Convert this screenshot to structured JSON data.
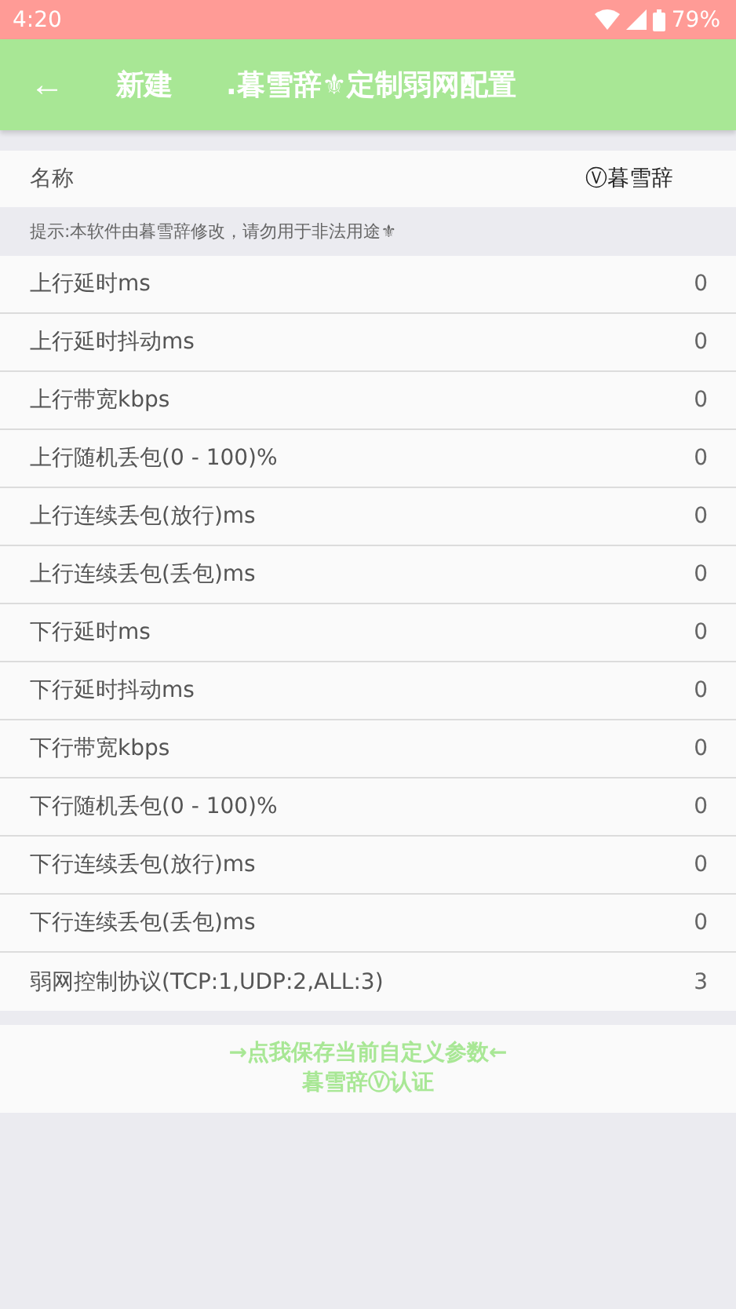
{
  "status_bar": {
    "time": "4:20",
    "battery": "79%"
  },
  "app_bar": {
    "back": "←",
    "title_prefix": "新建",
    "title": ".暮雪辞⚜定制弱网配置"
  },
  "name_row": {
    "label": "名称",
    "value": "Ⓥ暮雪辞"
  },
  "hint": "提示:本软件由暮雪辞修改，请勿用于非法用途⚜",
  "settings": [
    {
      "label": "上行延时ms",
      "value": "0"
    },
    {
      "label": "上行延时抖动ms",
      "value": "0"
    },
    {
      "label": "上行带宽kbps",
      "value": "0"
    },
    {
      "label": "上行随机丢包(0 - 100)%",
      "value": "0"
    },
    {
      "label": "上行连续丢包(放行)ms",
      "value": "0"
    },
    {
      "label": "上行连续丢包(丢包)ms",
      "value": "0"
    },
    {
      "label": "下行延时ms",
      "value": "0"
    },
    {
      "label": "下行延时抖动ms",
      "value": "0"
    },
    {
      "label": "下行带宽kbps",
      "value": "0"
    },
    {
      "label": "下行随机丢包(0 - 100)%",
      "value": "0"
    },
    {
      "label": "下行连续丢包(放行)ms",
      "value": "0"
    },
    {
      "label": "下行连续丢包(丢包)ms",
      "value": "0"
    },
    {
      "label": "弱网控制协议(TCP:1,UDP:2,ALL:3)",
      "value": "3"
    }
  ],
  "save_button": {
    "line_1": "→点我保存当前自定义参数←",
    "line_2": "暮雪辞Ⓥ认证"
  }
}
